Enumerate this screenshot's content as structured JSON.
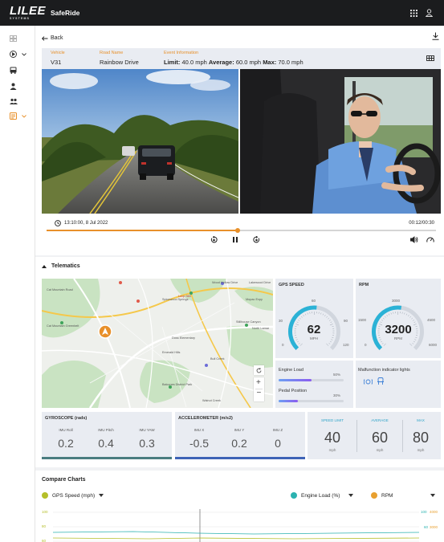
{
  "app": {
    "logo": "LILEE",
    "logo_sub": "SYSTEMS",
    "name": "SafeRide"
  },
  "nav": {
    "back_label": "Back"
  },
  "event": {
    "vehicle_label": "Vehicle",
    "vehicle": "V31",
    "road_label": "Road Name",
    "road": "Rainbow Drive",
    "info_label": "Event Information",
    "limit_label": "Limit:",
    "limit": "40.0 mph",
    "average_label": "Average:",
    "average": "60.0 mph",
    "max_label": "Max:",
    "max": "70.0 mph"
  },
  "player": {
    "timestamp": "13:10:00, 8 Jul 2022",
    "duration": "00:12/00:30",
    "progress": 0.49
  },
  "telematics": {
    "title": "Telematics"
  },
  "map": {
    "labels": [
      "Wood Hollow Drive",
      "Lakewood Drive",
      "Mopac Expy",
      "Cat Mountain Road",
      "Loop 360",
      "Spicewood Springs",
      "North Lamar",
      "Stillhouse Canyon",
      "Cat Mountain Greenbelt",
      "Bull Creek",
      "Doss Elementary",
      "Balcones District Park",
      "Walnut Creek",
      "Emerald Hills"
    ]
  },
  "gps": {
    "title": "GPS SPEED",
    "value": "62",
    "unit": "MPH",
    "min": "0",
    "t30": "30",
    "t60": "60",
    "t90": "90",
    "max": "120",
    "fraction": 0.52,
    "color": "#2bb2d6"
  },
  "rpm": {
    "title": "RPM",
    "value": "3200",
    "unit": "RPM",
    "min": "0",
    "t1500": "1500",
    "t3000": "3000",
    "t4500": "4500",
    "max": "6000",
    "fraction": 0.53,
    "color": "#2bb2d6"
  },
  "engine": {
    "load_label": "Engine Load",
    "load_pct": "50%",
    "load": 0.5,
    "pedal_label": "Pedal Position",
    "pedal_pct": "30%",
    "pedal": 0.3
  },
  "mil": {
    "title": "Malfunction indicator lights"
  },
  "gyro": {
    "title": "GYROSCOPE (rads)",
    "roll_label": "IMU Roll",
    "roll": "0.2",
    "pitch_label": "IMU Pitch",
    "pitch": "0.4",
    "yaw_label": "IMU YAW",
    "yaw": "0.3"
  },
  "accel": {
    "title": "ACCELEROMETER (m/s2)",
    "x_label": "IMU X",
    "x": "-0.5",
    "y_label": "IMU Y",
    "y": "0.2",
    "z_label": "IMU Z",
    "z": "0"
  },
  "speeds": {
    "limit_label": "SPEED LIMIT",
    "limit": "40",
    "limit_unit": "mph",
    "avg_label": "AVERAGE",
    "avg": "60",
    "avg_unit": "mph",
    "max_label": "MAX",
    "max": "80",
    "max_unit": "mph"
  },
  "compare": {
    "title": "Compare Charts",
    "sel1": "GPS Speed (mph)",
    "sel1_color": "#b5bf2a",
    "sel2": "Engine Load (%)",
    "sel2_color": "#2bb2b0",
    "sel3": "RPM",
    "sel3_color": "#e8a030",
    "left_100": "100",
    "left_80": "80",
    "left_60": "60",
    "right_100": "100",
    "right_4000": "4000",
    "right_60": "60",
    "right_3000": "3000"
  }
}
